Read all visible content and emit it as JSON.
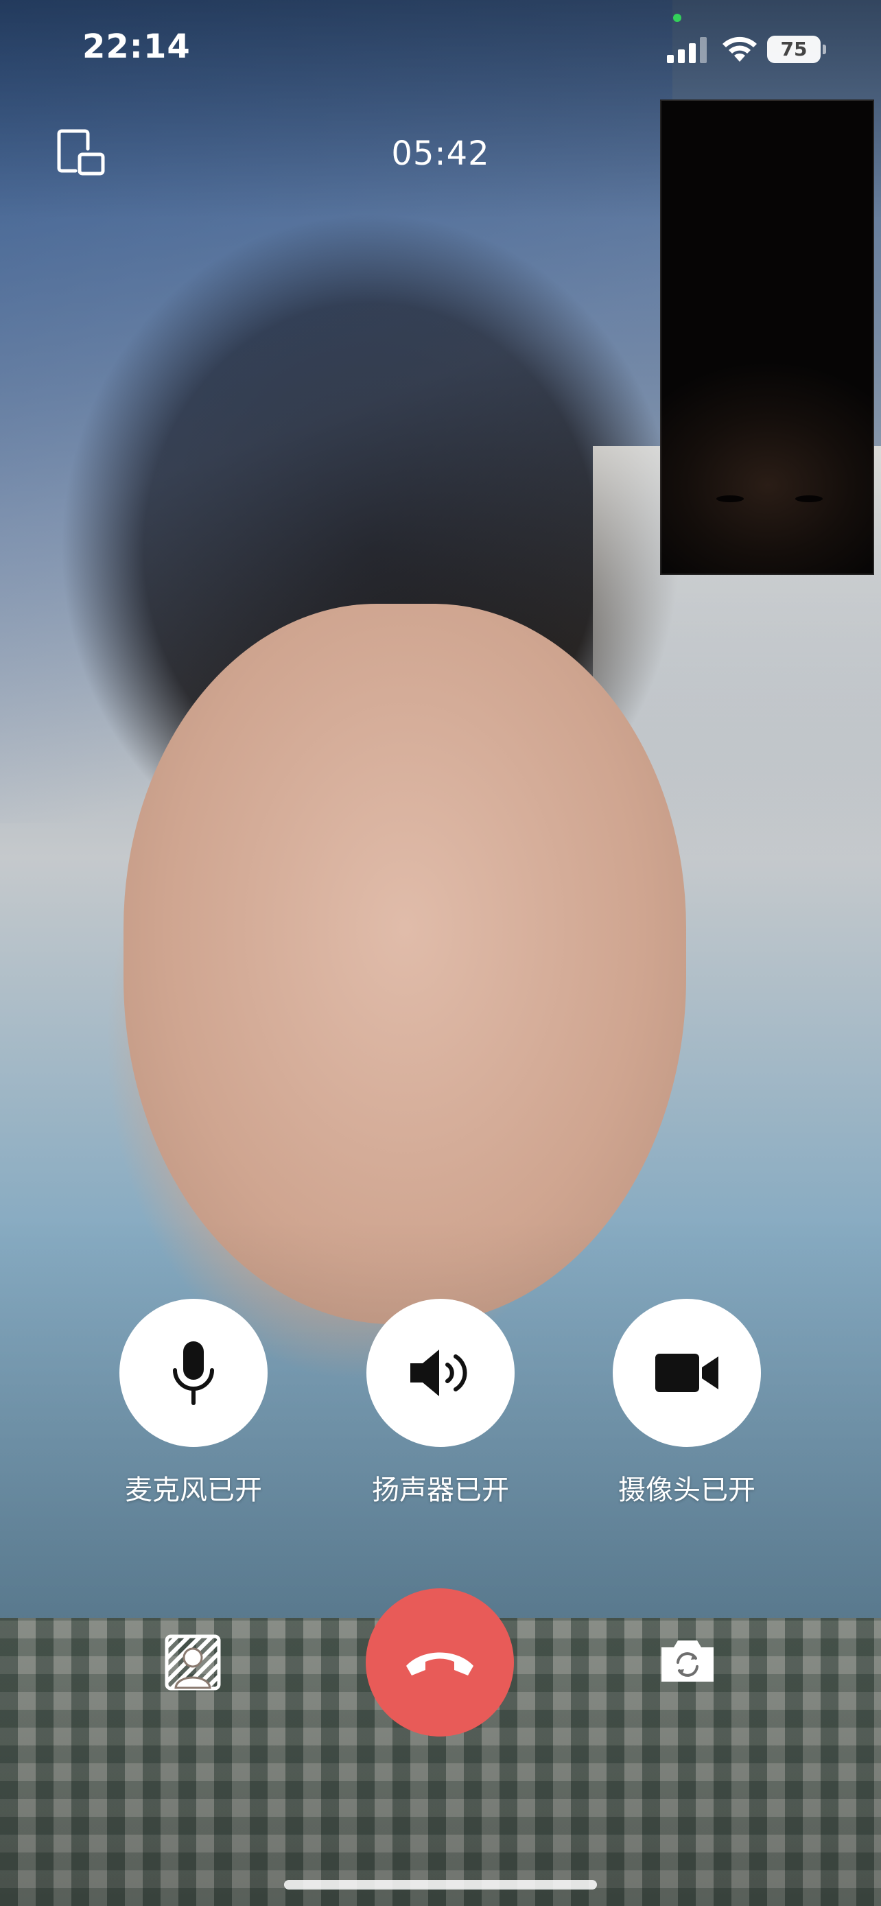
{
  "status_bar": {
    "time": "22:14",
    "battery_level": "75",
    "signal_icon": "cellular-signal-icon",
    "wifi_icon": "wifi-icon"
  },
  "call": {
    "duration": "05:42"
  },
  "controls": {
    "microphone": {
      "label": "麦克风已开",
      "icon": "microphone-icon"
    },
    "speaker": {
      "label": "扬声器已开",
      "icon": "speaker-icon"
    },
    "camera": {
      "label": "摄像头已开",
      "icon": "video-camera-icon"
    }
  },
  "bottom_actions": {
    "background_blur_icon": "background-blur-icon",
    "hangup_icon": "phone-hangup-icon",
    "switch_camera_icon": "switch-camera-icon"
  },
  "colors": {
    "hangup": "#e85b58",
    "control_button_bg": "#ffffff",
    "privacy_indicator": "#33d15a"
  }
}
